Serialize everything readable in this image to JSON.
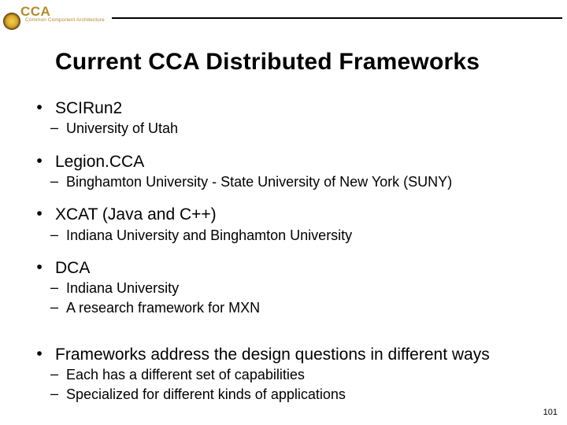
{
  "header": {
    "logo_text": "CCA",
    "logo_subtext": "Common Component Architecture"
  },
  "title": "Current CCA Distributed Frameworks",
  "bullets": [
    {
      "text": "SCIRun2",
      "subs": [
        "University of Utah"
      ]
    },
    {
      "text": "Legion.CCA",
      "subs": [
        "Binghamton University - State University of New York (SUNY)"
      ]
    },
    {
      "text": "XCAT (Java and C++)",
      "subs": [
        "Indiana University and Binghamton University"
      ]
    },
    {
      "text": "DCA",
      "subs": [
        "Indiana University",
        "A research framework for MXN"
      ]
    },
    {
      "text": "Frameworks address the design questions in different ways",
      "gap_before": true,
      "subs": [
        "Each has a different set of capabilities",
        "Specialized for different kinds of applications"
      ]
    }
  ],
  "page_number": "101"
}
